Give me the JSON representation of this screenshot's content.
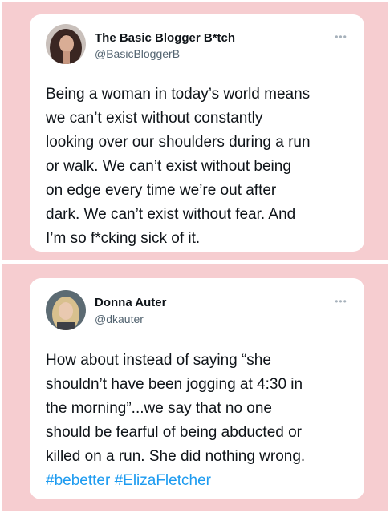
{
  "tweets": [
    {
      "author_name": "The Basic Blogger B*tch",
      "author_handle": "@BasicBloggerB",
      "more_icon": "ellipsis-icon",
      "text_lines": [
        "Being a woman in today’s world means",
        "we can’t exist without constantly",
        "looking over our shoulders during a run",
        "or walk. We can’t exist without being",
        "on edge every time we’re out after",
        "dark. We can’t exist without fear. And",
        "I’m so f*cking sick of it."
      ]
    },
    {
      "author_name": "Donna Auter",
      "author_handle": "@dkauter",
      "more_icon": "ellipsis-icon",
      "text_lines": [
        "How about instead of saying “she",
        "shouldn’t have been jogging at 4:30 in",
        "the morning”...we say that no one",
        "should be fearful of being abducted or",
        "killed on a run. She did nothing wrong."
      ],
      "hashtags": [
        "#bebetter",
        "#ElizaFletcher"
      ]
    }
  ],
  "colors": {
    "background": "#f6cdd0",
    "card": "#ffffff",
    "text": "#0f1419",
    "secondary_text": "#536471",
    "hashtag": "#1d9bf0"
  }
}
